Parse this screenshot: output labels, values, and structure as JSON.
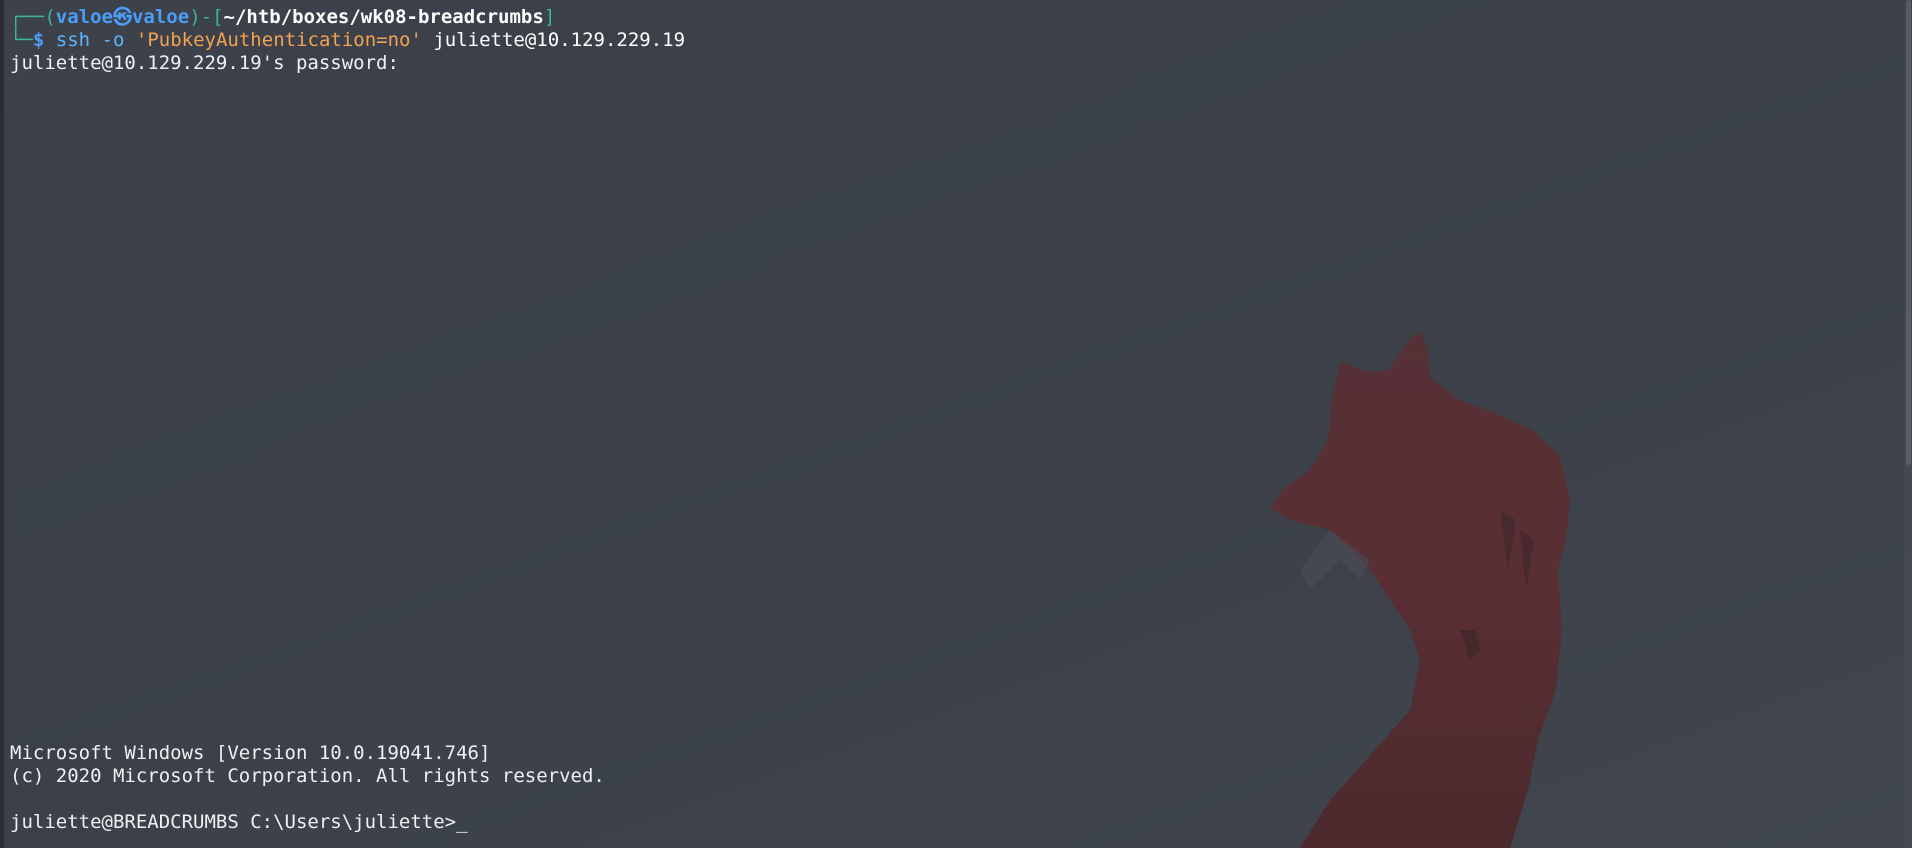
{
  "prompt": {
    "corner_top": "┌──(",
    "user": "valoe",
    "at_symbol": "㉿",
    "host": "valoe",
    "mid": ")-[",
    "path": "~/htb/boxes/wk08-breadcrumbs",
    "end": "]",
    "corner_bottom": "└─",
    "dollar": "$"
  },
  "command": {
    "program": "ssh",
    "flag": "-o",
    "option": "'PubkeyAuthentication=no'",
    "target": "juliette@10.129.229.19"
  },
  "password_prompt": "juliette@10.129.229.19's password:",
  "windows_banner": {
    "version_line": "Microsoft Windows [Version 10.0.19041.746]",
    "copyright_line": "(c) 2020 Microsoft Corporation. All rights reserved."
  },
  "cmd_prompt": "juliette@BREADCRUMBS C:\\Users\\juliette>",
  "cursor": "_",
  "colors": {
    "background": "#3a3f47",
    "prompt_green": "#3fb39b",
    "prompt_blue": "#4a9df8",
    "string_orange": "#f2a251",
    "command_blue": "#59b6ff"
  },
  "wallpaper": "red-fox-silhouette"
}
